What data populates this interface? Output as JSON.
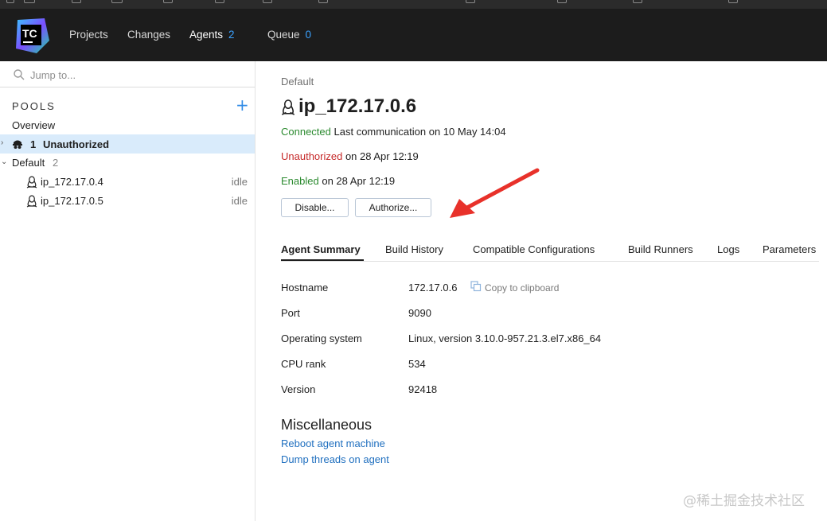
{
  "header": {
    "logo_text": "TC",
    "nav": [
      {
        "label": "Projects"
      },
      {
        "label": "Changes"
      },
      {
        "label": "Agents",
        "count": "2"
      },
      {
        "label": "Queue",
        "count": "0"
      }
    ]
  },
  "sidebar": {
    "search_placeholder": "Jump to...",
    "pools_title": "POOLS",
    "add_icon": "+",
    "overview_label": "Overview",
    "unauthorized": {
      "count": "1",
      "label": "Unauthorized"
    },
    "default_pool": {
      "label": "Default",
      "count": "2"
    },
    "agents": [
      {
        "name": "ip_172.17.0.4",
        "status": "idle"
      },
      {
        "name": "ip_172.17.0.5",
        "status": "idle"
      }
    ]
  },
  "main": {
    "breadcrumb": "Default",
    "title": "ip_172.17.0.6",
    "connection": {
      "state": "Connected",
      "text": "Last communication on 10 May 14:04"
    },
    "authorization": {
      "state": "Unauthorized",
      "text": "on 28 Apr 12:19"
    },
    "enabled": {
      "state": "Enabled",
      "text": "on 28 Apr 12:19"
    },
    "buttons": {
      "disable": "Disable...",
      "authorize": "Authorize..."
    },
    "tabs": [
      "Agent Summary",
      "Build History",
      "Compatible Configurations",
      "Build Runners",
      "Logs",
      "Parameters"
    ],
    "summary": [
      {
        "label": "Hostname",
        "value": "172.17.0.6"
      },
      {
        "label": "Port",
        "value": "9090"
      },
      {
        "label": "Operating system",
        "value": "Linux, version 3.10.0-957.21.3.el7.x86_64"
      },
      {
        "label": "CPU rank",
        "value": "534"
      },
      {
        "label": "Version",
        "value": "92418"
      }
    ],
    "copy_label": "Copy to clipboard",
    "misc_title": "Miscellaneous",
    "links": [
      "Reboot agent machine",
      "Dump threads on agent"
    ]
  },
  "watermark": "@稀土掘金技术社区",
  "colors": {
    "header_bg": "#1c1c1c",
    "accent": "#3ba2ff",
    "connected": "#2b8a2f",
    "unauthorized": "#c62a2a",
    "link": "#1f6fbf",
    "selected_row": "#d9ebfb",
    "annotation_arrow": "#e8312a"
  }
}
